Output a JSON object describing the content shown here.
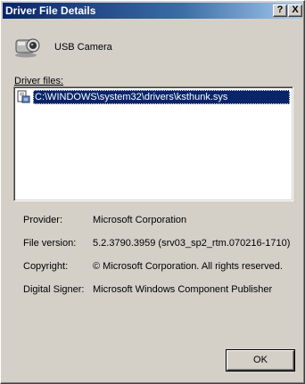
{
  "window": {
    "title": "Driver File Details",
    "help_symbol": "?",
    "close_symbol": "X"
  },
  "device": {
    "icon": "usb-camera-icon",
    "name": "USB Camera"
  },
  "driver_files": {
    "label": "Driver files:",
    "items": [
      {
        "icon": "driver-file-icon",
        "path": "C:\\WINDOWS\\system32\\drivers\\ksthunk.sys",
        "selected": true
      }
    ]
  },
  "details": {
    "provider_label": "Provider:",
    "provider_value": "Microsoft Corporation",
    "version_label": "File version:",
    "version_value": "5.2.3790.3959 (srv03_sp2_rtm.070216-1710)",
    "copyright_label": "Copyright:",
    "copyright_value": "© Microsoft Corporation. All rights reserved.",
    "signer_label": "Digital Signer:",
    "signer_value": "Microsoft Windows Component Publisher"
  },
  "buttons": {
    "ok_label": "OK"
  },
  "colors": {
    "titlebar_start": "#0a246a",
    "titlebar_end": "#a6caf0",
    "selection": "#0a246a",
    "dialog_bg": "#d4d0c8"
  }
}
